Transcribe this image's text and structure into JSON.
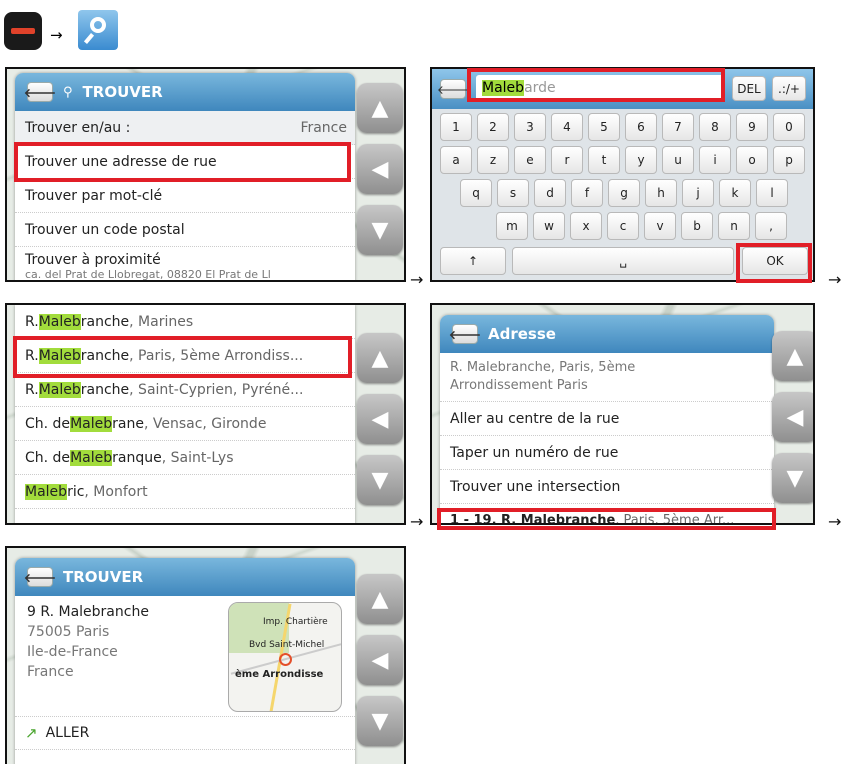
{
  "header": {
    "arrow": "→"
  },
  "step1": {
    "title": "TROUVER",
    "rows": [
      {
        "label": "Trouver en/au :",
        "value": "France"
      },
      {
        "label": "Trouver une adresse de rue"
      },
      {
        "label": "Trouver par mot-clé"
      },
      {
        "label": "Trouver un code postal"
      },
      {
        "label": "Trouver à proximité",
        "sub": "ca. del Prat de Llobregat, 08820 El Prat de Ll"
      }
    ]
  },
  "step2": {
    "input_highlight": "Maleb",
    "input_rest": "arde",
    "del_label": "DEL",
    "sym_label": ".:/+",
    "keys_row1": [
      "1",
      "2",
      "3",
      "4",
      "5",
      "6",
      "7",
      "8",
      "9",
      "0"
    ],
    "keys_row2": [
      "a",
      "z",
      "e",
      "r",
      "t",
      "y",
      "u",
      "i",
      "o",
      "p"
    ],
    "keys_row3": [
      "q",
      "s",
      "d",
      "f",
      "g",
      "h",
      "j",
      "k",
      "l"
    ],
    "keys_row4": [
      "m",
      "w",
      "x",
      "c",
      "v",
      "b",
      "n",
      ","
    ],
    "shift_label": "↑",
    "space_label": "␣",
    "ok_label": "OK"
  },
  "step3": {
    "results": [
      {
        "prefix": "R. ",
        "hl": "Maleb",
        "rest": "ranche",
        "loc": ", Marines"
      },
      {
        "prefix": "R. ",
        "hl": "Maleb",
        "rest": "ranche",
        "loc": ", Paris, 5ème Arrondiss..."
      },
      {
        "prefix": "R. ",
        "hl": "Maleb",
        "rest": "ranche",
        "loc": ", Saint-Cyprien, Pyréné..."
      },
      {
        "prefix": "Ch. de ",
        "hl": "Maleb",
        "rest": "rane",
        "loc": ", Vensac, Gironde"
      },
      {
        "prefix": "Ch. de ",
        "hl": "Maleb",
        "rest": "ranque",
        "loc": ", Saint-Lys"
      },
      {
        "prefix": "",
        "hl": "Maleb",
        "rest": "ric",
        "loc": ", Monfort"
      }
    ]
  },
  "step4": {
    "title": "Adresse",
    "address_line1": "R. Malebranche, Paris, 5ème",
    "address_line2": "Arrondissement Paris",
    "options": [
      "Aller au centre de la rue",
      "Taper un numéro de rue",
      "Trouver une intersection"
    ],
    "range_bold": "1 - 19, R. Malebranche",
    "range_rest": ", Paris, 5ème Arr..."
  },
  "step5": {
    "title": "TROUVER",
    "line1": "9 R. Malebranche",
    "line2": "75005 Paris",
    "line3": "Ile-de-France",
    "line4": "France",
    "map_label1": "Imp. Chartière",
    "map_label2": "Bvd Saint-Michel",
    "map_label3": "ème Arrondisse",
    "go_label": "ALLER"
  }
}
